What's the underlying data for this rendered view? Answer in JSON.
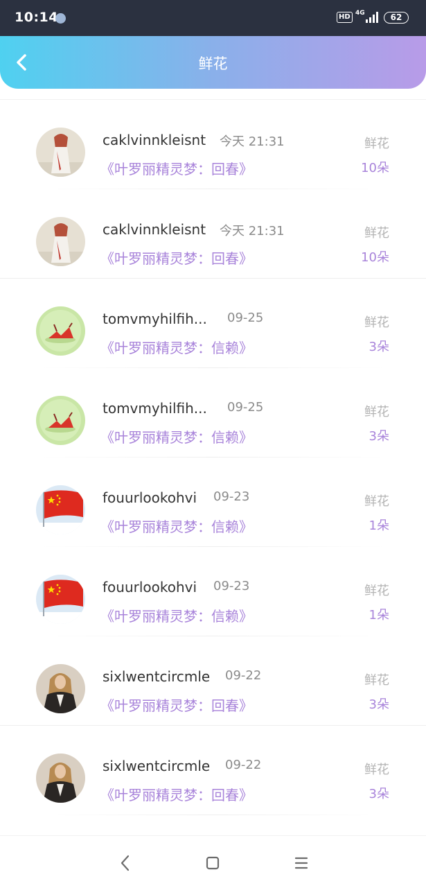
{
  "status_bar": {
    "time": "10:14",
    "hd": "HD",
    "network": "4G",
    "battery": "62"
  },
  "header": {
    "title": "鲜花",
    "back_icon": "chevron-left-icon"
  },
  "rows": [
    {
      "username": "caklvinnkleisnt",
      "time": "今天 21:31",
      "gift": "《叶罗丽精灵梦：回春》",
      "type": "鲜花",
      "count": "10朵",
      "avatar": "white-dress-girl"
    },
    {
      "username": "caklvinnkleisnt",
      "time": "今天 21:31",
      "gift": "《叶罗丽精灵梦：回春》",
      "type": "鲜花",
      "count": "10朵",
      "avatar": "white-dress-girl"
    },
    {
      "username": "tomvmyhilfih...",
      "time": "09-25",
      "gift": "《叶罗丽精灵梦：信赖》",
      "type": "鲜花",
      "count": "3朵",
      "avatar": "green-red-figure"
    },
    {
      "username": "tomvmyhilfih...",
      "time": "09-25",
      "gift": "《叶罗丽精灵梦：信赖》",
      "type": "鲜花",
      "count": "3朵",
      "avatar": "green-red-figure"
    },
    {
      "username": "fouurlookohvi",
      "time": "09-23",
      "gift": "《叶罗丽精灵梦：信赖》",
      "type": "鲜花",
      "count": "1朵",
      "avatar": "china-flag"
    },
    {
      "username": "fouurlookohvi",
      "time": "09-23",
      "gift": "《叶罗丽精灵梦：信赖》",
      "type": "鲜花",
      "count": "1朵",
      "avatar": "china-flag"
    },
    {
      "username": "sixlwentcircmle",
      "time": "09-22",
      "gift": "《叶罗丽精灵梦：回春》",
      "type": "鲜花",
      "count": "3朵",
      "avatar": "leather-jacket-person"
    },
    {
      "username": "sixlwentcircmle",
      "time": "09-22",
      "gift": "《叶罗丽精灵梦：回春》",
      "type": "鲜花",
      "count": "3朵",
      "avatar": "leather-jacket-person"
    }
  ],
  "nav_bar": {
    "back_icon": "triangle-back-icon",
    "home_icon": "square-home-icon",
    "menu_icon": "menu-lines-icon"
  },
  "colors": {
    "accent": "#a883da",
    "header_gradient_start": "#4fd1f0",
    "header_gradient_end": "#b89be8",
    "muted": "#b3b3b3"
  }
}
